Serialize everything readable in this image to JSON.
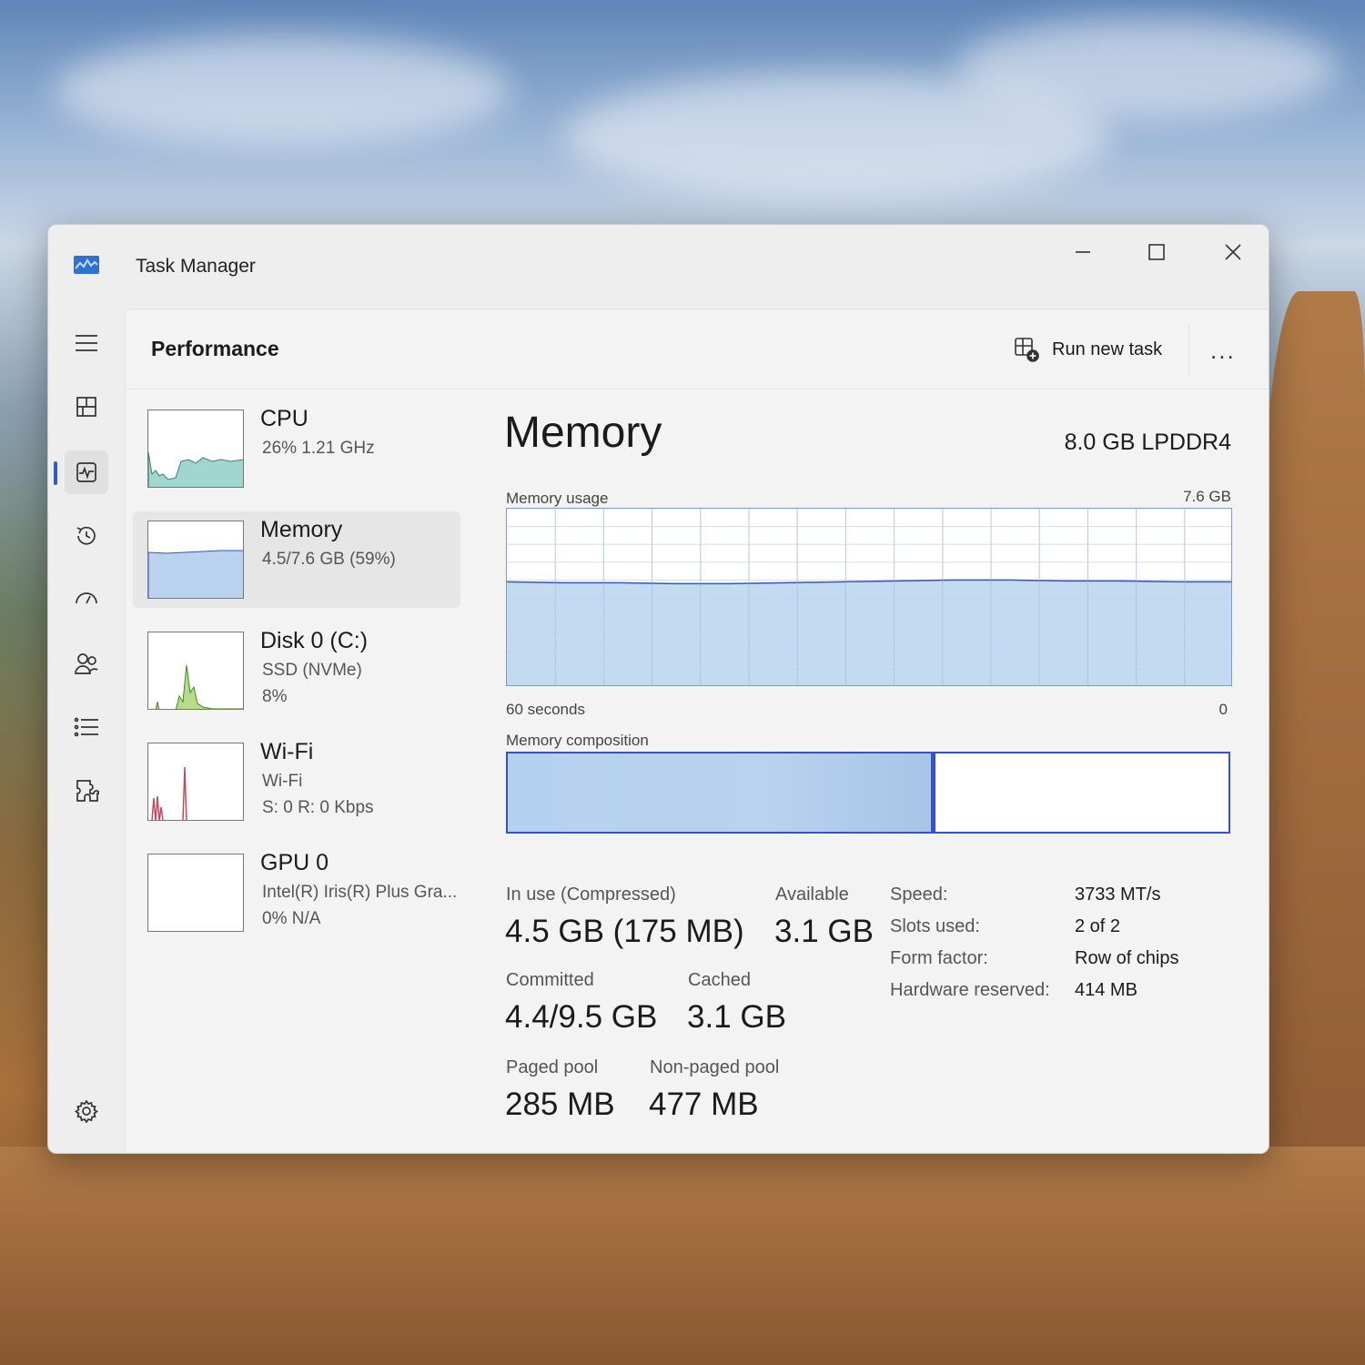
{
  "window": {
    "title": "Task Manager",
    "controls": {
      "minimize_icon": "minimize-icon",
      "maximize_icon": "maximize-icon",
      "close_icon": "close-icon"
    }
  },
  "nav": {
    "items": [
      {
        "icon": "hamburger-menu-icon"
      },
      {
        "icon": "processes-icon"
      },
      {
        "icon": "performance-icon",
        "active": true
      },
      {
        "icon": "app-history-icon"
      },
      {
        "icon": "startup-apps-icon"
      },
      {
        "icon": "users-icon"
      },
      {
        "icon": "details-icon"
      },
      {
        "icon": "services-icon"
      },
      {
        "icon": "settings-icon"
      }
    ]
  },
  "header": {
    "page_title": "Performance",
    "run_new_task": "Run new task",
    "more": "..."
  },
  "devices": [
    {
      "name": "CPU",
      "line1": "26%  1.21 GHz",
      "line2": ""
    },
    {
      "name": "Memory",
      "line1": "4.5/7.6 GB (59%)",
      "line2": ""
    },
    {
      "name": "Disk 0 (C:)",
      "line1": "SSD (NVMe)",
      "line2": "8%"
    },
    {
      "name": "Wi-Fi",
      "line1": "Wi-Fi",
      "line2": "S: 0  R: 0 Kbps"
    },
    {
      "name": "GPU 0",
      "line1": "Intel(R) Iris(R) Plus Gra...",
      "line2": "0%  N/A"
    }
  ],
  "memory": {
    "title": "Memory",
    "spec": "8.0 GB LPDDR4",
    "usage_label": "Memory usage",
    "usage_max": "7.6 GB",
    "time_label": "60 seconds",
    "time_end": "0",
    "composition_label": "Memory composition",
    "composition_in_use_fraction": 0.59,
    "stats": {
      "in_use_label": "In use (Compressed)",
      "in_use_value": "4.5 GB (175 MB)",
      "available_label": "Available",
      "available_value": "3.1 GB",
      "committed_label": "Committed",
      "committed_value": "4.4/9.5 GB",
      "cached_label": "Cached",
      "cached_value": "3.1 GB",
      "paged_label": "Paged pool",
      "paged_value": "285 MB",
      "nonpaged_label": "Non-paged pool",
      "nonpaged_value": "477 MB"
    },
    "specs": [
      {
        "key": "Speed:",
        "value": "3733 MT/s"
      },
      {
        "key": "Slots used:",
        "value": "2 of 2"
      },
      {
        "key": "Form factor:",
        "value": "Row of chips"
      },
      {
        "key": "Hardware reserved:",
        "value": "414 MB"
      }
    ],
    "usage_history_fraction": [
      0.59,
      0.585,
      0.585,
      0.58,
      0.58,
      0.585,
      0.59,
      0.595,
      0.6,
      0.6,
      0.595,
      0.595,
      0.59,
      0.59
    ]
  },
  "colors": {
    "accent": "#2a5bd7",
    "memory_fill": "#b9d3ef",
    "memory_line": "#3552c7",
    "cpu_fill": "#9fd6d0",
    "disk_fill": "#b5dc8a",
    "wifi_line": "#c24a5a"
  }
}
